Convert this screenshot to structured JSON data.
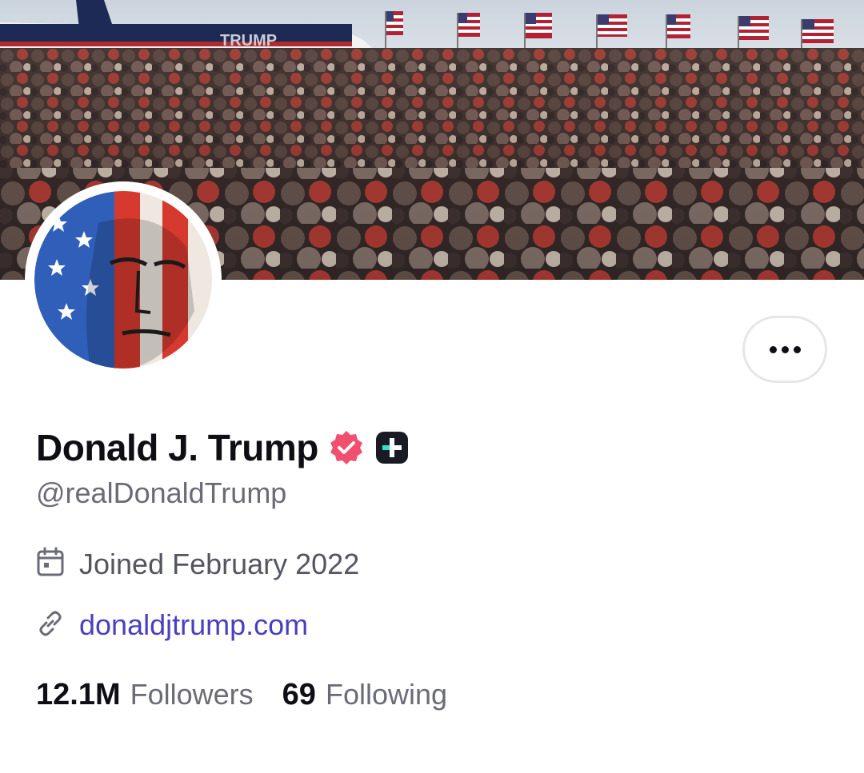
{
  "profile": {
    "display_name": "Donald J. Trump",
    "handle": "@realDonaldTrump",
    "joined": "Joined February 2022",
    "website": "donaldjtrump.com",
    "verified_badge_color": "#f0506e",
    "plus_badge_color": "#1a1a24"
  },
  "banner": {
    "plane_text": "TRUMP"
  },
  "stats": {
    "followers_count": "12.1M",
    "followers_label": "Followers",
    "following_count": "69",
    "following_label": "Following"
  },
  "icons": {
    "more": "more-horizontal-icon",
    "calendar": "calendar-icon",
    "link": "link-icon",
    "verified": "verified-badge-icon",
    "plus": "plus-badge-icon"
  },
  "colors": {
    "link": "#4a3fbf",
    "muted": "#6b6b78",
    "text": "#0e0e14"
  }
}
